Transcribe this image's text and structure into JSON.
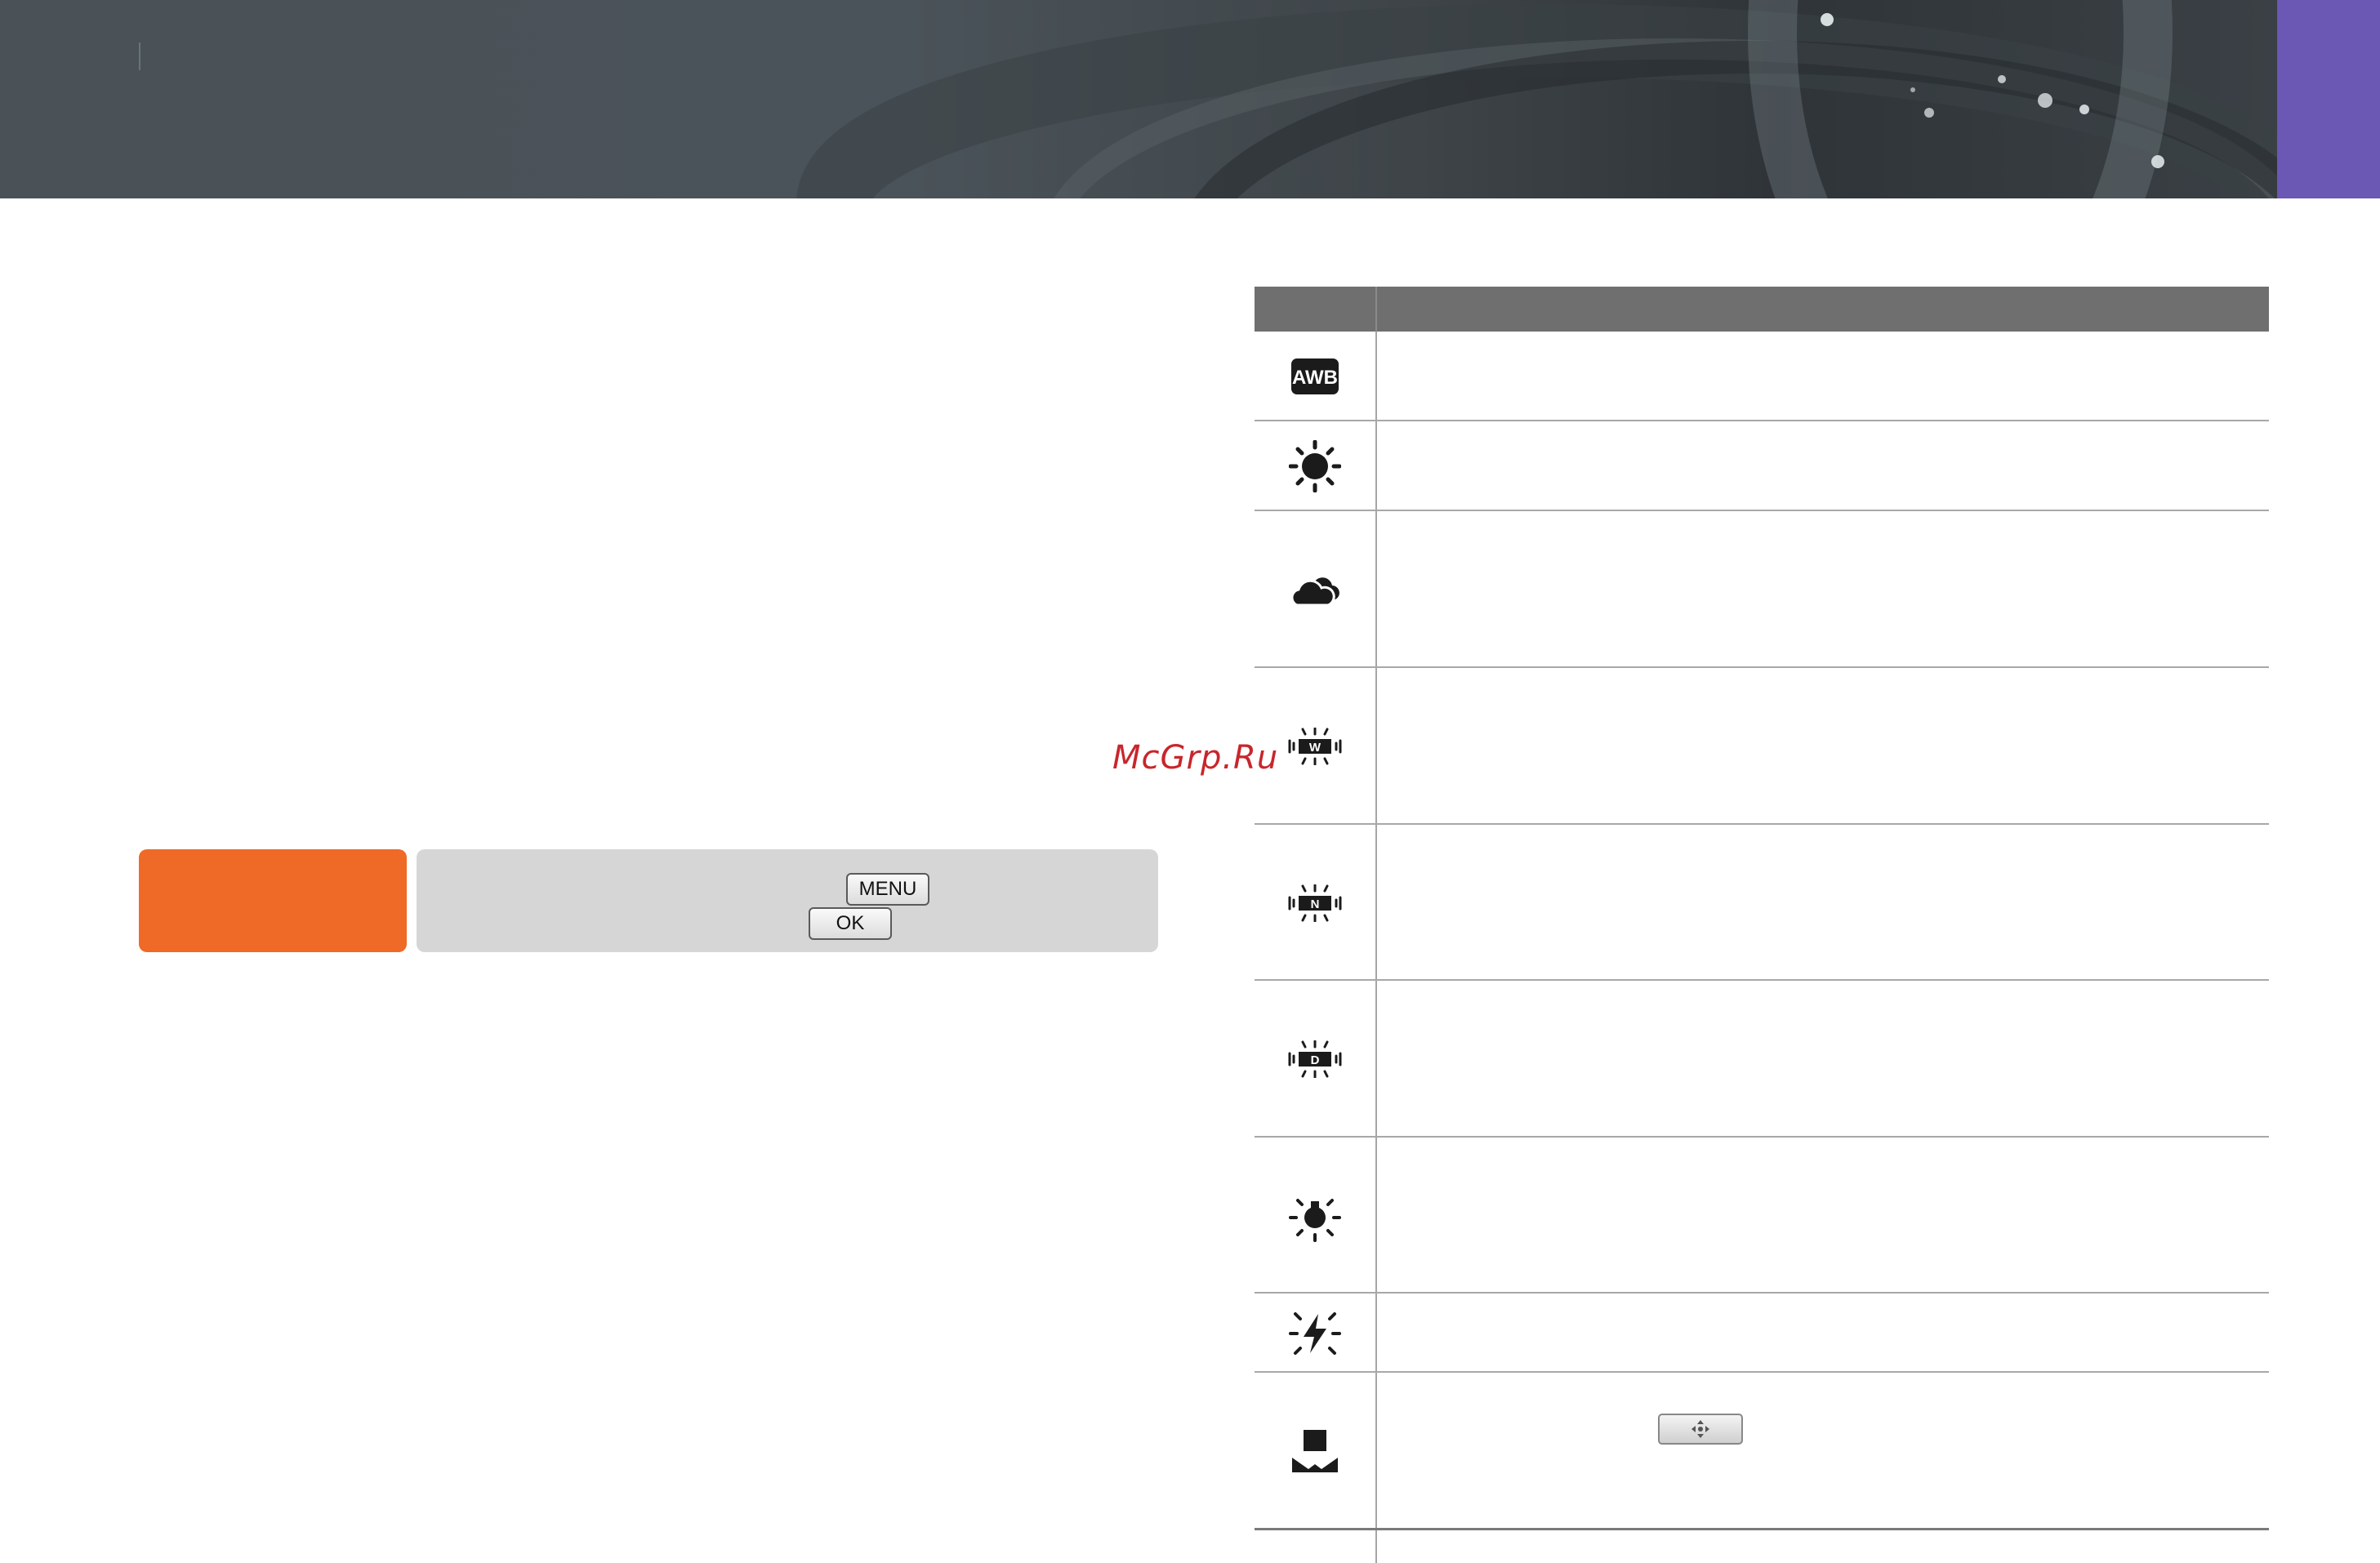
{
  "header": {
    "background_color": "#4a5359",
    "tab_color": "#6b57b4"
  },
  "watermark": {
    "text": "McGrp.Ru",
    "color": "#c8262c"
  },
  "note": {
    "label_color": "#ee6a26",
    "body_color": "#d6d6d6",
    "keys": {
      "menu": "MENU",
      "ok": "OK"
    }
  },
  "white_balance_table": {
    "rows": [
      {
        "icon": "awb-icon",
        "badge": "AWB"
      },
      {
        "icon": "daylight-sun-icon"
      },
      {
        "icon": "cloudy-icon"
      },
      {
        "icon": "fluorescent-w-icon",
        "badge": "W"
      },
      {
        "icon": "fluorescent-n-icon",
        "badge": "N"
      },
      {
        "icon": "fluorescent-d-icon",
        "badge": "D"
      },
      {
        "icon": "tungsten-bulb-icon"
      },
      {
        "icon": "flash-wb-icon"
      },
      {
        "icon": "custom-set-icon"
      }
    ]
  }
}
